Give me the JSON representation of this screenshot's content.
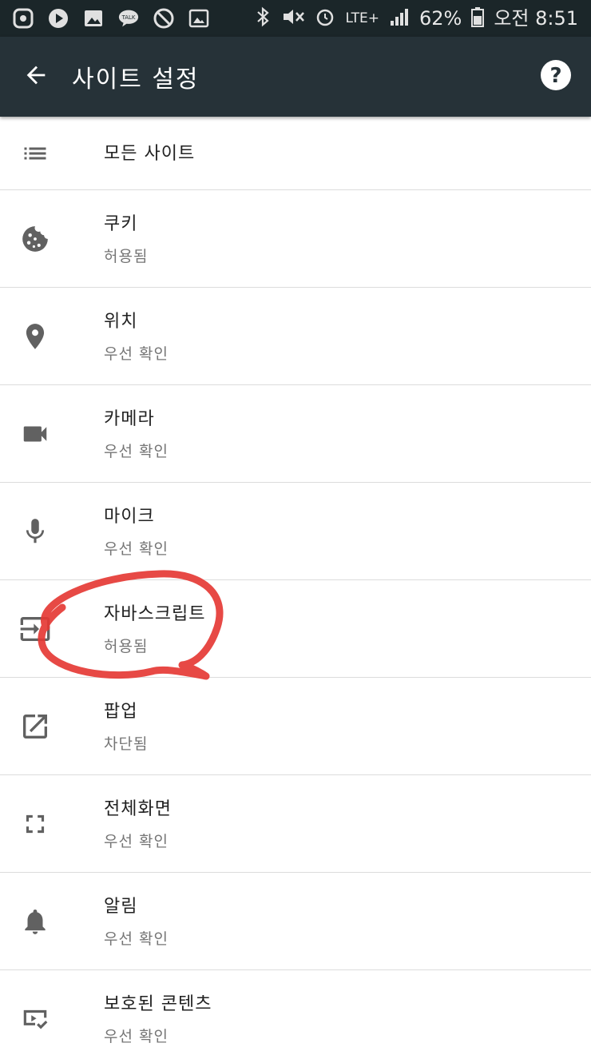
{
  "status_bar": {
    "battery": "62%",
    "time": "오전 8:51",
    "network": "LTE+"
  },
  "app_bar": {
    "title": "사이트 설정",
    "back_icon": "arrow-left-icon",
    "help_icon": "help-circle-icon"
  },
  "items": [
    {
      "title": "모든 사이트",
      "subtitle": "",
      "icon": "list-icon"
    },
    {
      "title": "쿠키",
      "subtitle": "허용됨",
      "icon": "cookie-icon"
    },
    {
      "title": "위치",
      "subtitle": "우선 확인",
      "icon": "location-pin-icon"
    },
    {
      "title": "카메라",
      "subtitle": "우선 확인",
      "icon": "videocam-icon"
    },
    {
      "title": "마이크",
      "subtitle": "우선 확인",
      "icon": "mic-icon"
    },
    {
      "title": "자바스크립트",
      "subtitle": "허용됨",
      "icon": "input-icon"
    },
    {
      "title": "팝업",
      "subtitle": "차단됨",
      "icon": "open-in-new-icon"
    },
    {
      "title": "전체화면",
      "subtitle": "우선 확인",
      "icon": "fullscreen-icon"
    },
    {
      "title": "알림",
      "subtitle": "우선 확인",
      "icon": "bell-icon"
    },
    {
      "title": "보호된 콘텐츠",
      "subtitle": "우선 확인",
      "icon": "protected-content-icon"
    }
  ],
  "colors": {
    "status_bar_bg": "#1b2629",
    "app_bar_bg": "#263238",
    "icon": "#616161",
    "annotation": "#e53935"
  }
}
